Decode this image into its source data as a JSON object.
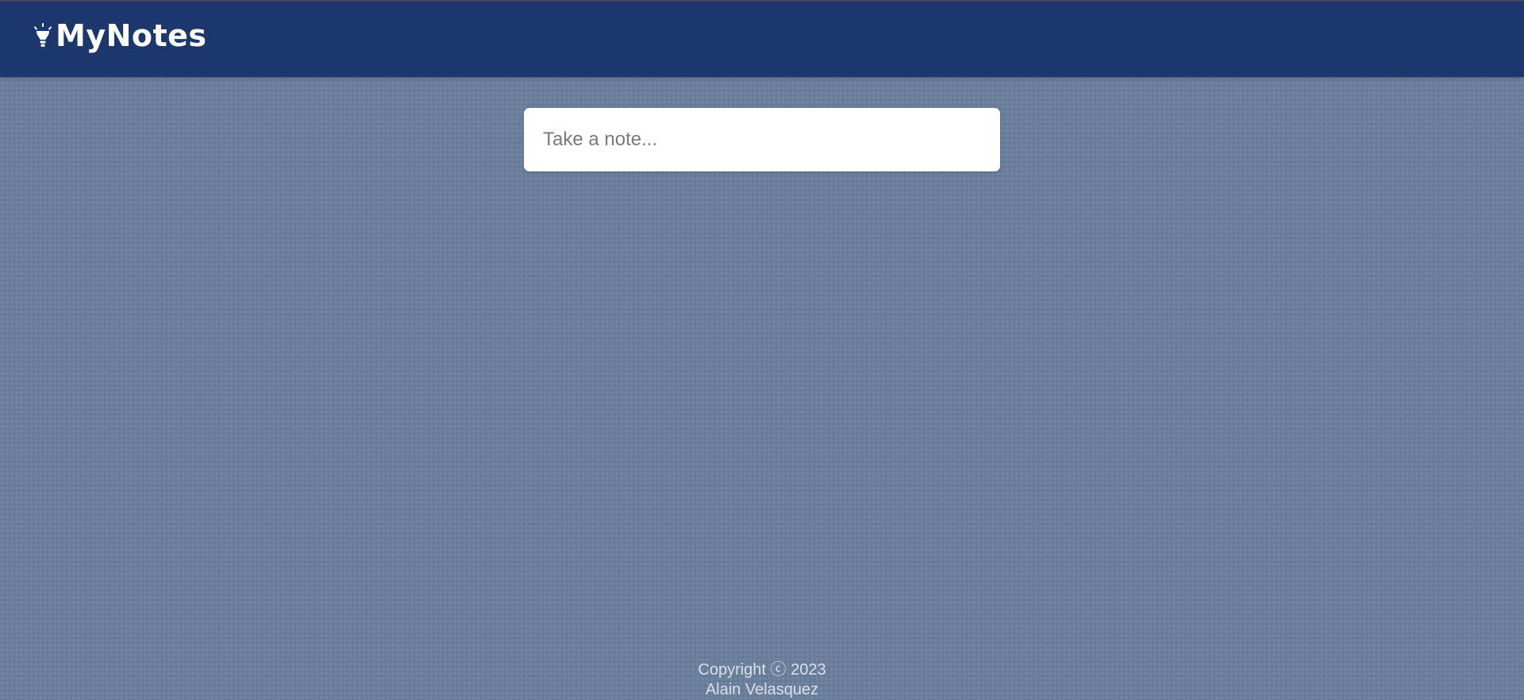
{
  "header": {
    "title": "MyNotes",
    "icon": "lightbulb-icon",
    "background_color": "#1b376c"
  },
  "composer": {
    "placeholder": "Take a note...",
    "value": ""
  },
  "footer": {
    "copyright": "Copyright ⓒ 2023",
    "author": "Alain Velasquez"
  },
  "colors": {
    "page_background": "#6a7f9c",
    "header": "#1b376c",
    "footer_text": "#d9e0ea"
  }
}
